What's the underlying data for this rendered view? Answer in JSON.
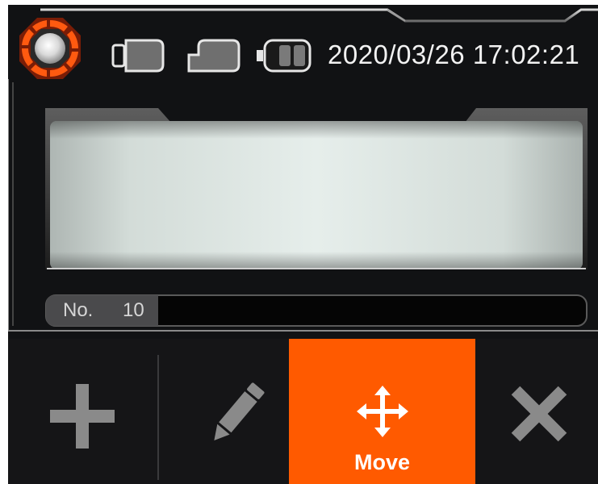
{
  "status": {
    "datetime": "2020/03/26 17:02:21"
  },
  "counter": {
    "label": "No.",
    "value": "10"
  },
  "toolbar": {
    "add_label": "",
    "edit_label": "",
    "move_label": "Move",
    "delete_label": ""
  },
  "colors": {
    "accent": "#ff5a00",
    "background": "#111214",
    "lcd": "#dde6e2"
  },
  "icons": {
    "camera": "shutter-ring-icon",
    "card1": "sd-card-icon",
    "card2": "memory-card-icon",
    "battery": "battery-icon",
    "add": "plus-icon",
    "edit": "pencil-icon",
    "move": "move-arrows-icon",
    "delete": "close-icon"
  }
}
